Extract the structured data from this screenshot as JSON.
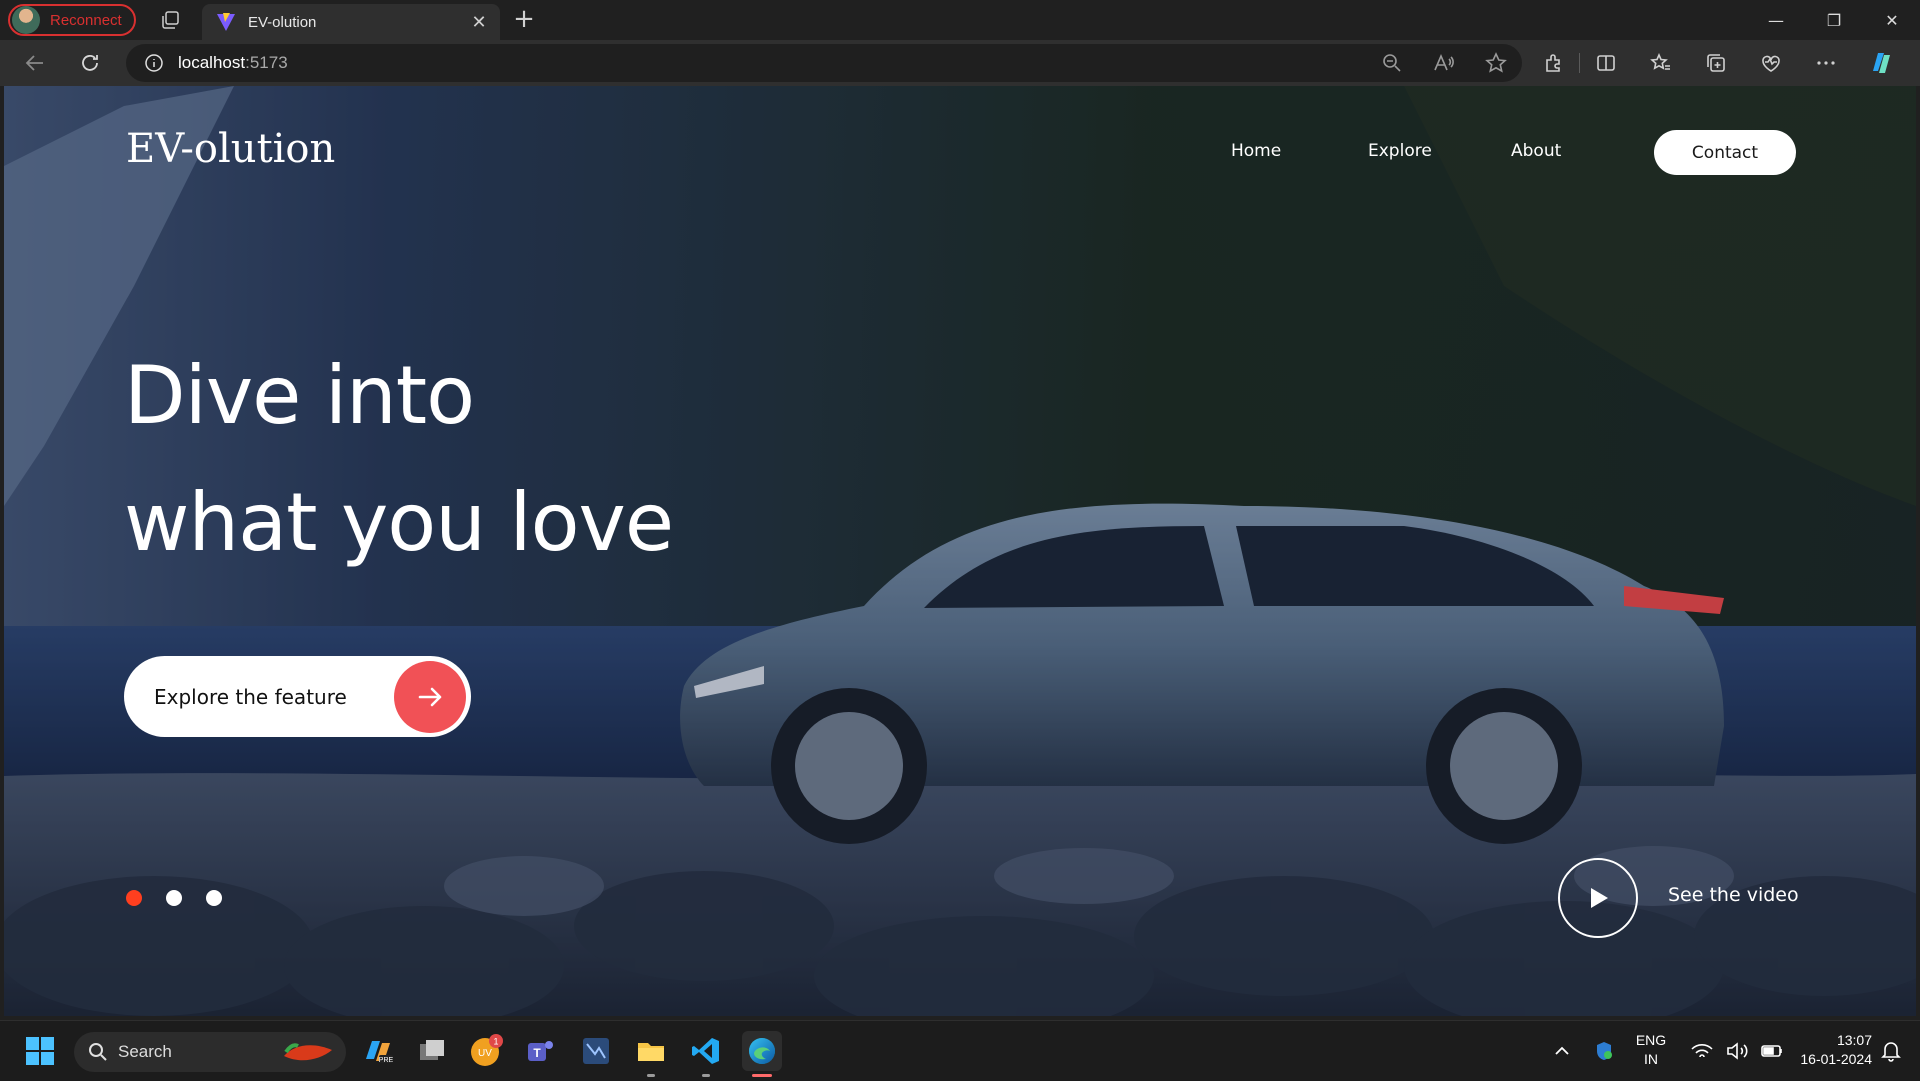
{
  "browser": {
    "profile_label": "Reconnect",
    "tab_title": "EV-olution",
    "url_host": "localhost",
    "url_port": ":5173",
    "icons": [
      "tab-actions-icon",
      "favicon",
      "close-icon",
      "plus-icon",
      "back-icon",
      "refresh-icon",
      "info-icon",
      "zoom-icon",
      "read-aloud-icon",
      "star-icon",
      "extensions-icon",
      "split-screen-icon",
      "favorites-icon",
      "collections-icon",
      "browser-essentials-icon",
      "more-icon",
      "copilot-icon"
    ],
    "window": {
      "minimize": "—",
      "restore": "❐",
      "close": "✕"
    }
  },
  "page": {
    "logo": "EV-olution",
    "nav": [
      "Home",
      "Explore",
      "About"
    ],
    "contact_label": "Contact",
    "headline_line1": "Dive into",
    "headline_line2": "what you love",
    "cta_label": "Explore the feature",
    "slider": {
      "count": 3,
      "active": 0
    },
    "video_label": "See the video",
    "colors": {
      "accent": "#f15156",
      "active_dot": "#ff3f1f"
    }
  },
  "taskbar": {
    "search_placeholder": "Search",
    "apps": [
      "windows-start-icon",
      "copilot-icon",
      "task-view-icon",
      "app-badge-icon",
      "teams-icon",
      "app-icon",
      "file-explorer-icon",
      "vscode-icon",
      "edge-icon"
    ],
    "notification_badge": "1",
    "badge_app_label": "UV",
    "lang_line1": "ENG",
    "lang_line2": "IN",
    "time": "13:07",
    "date": "16-01-2024"
  }
}
